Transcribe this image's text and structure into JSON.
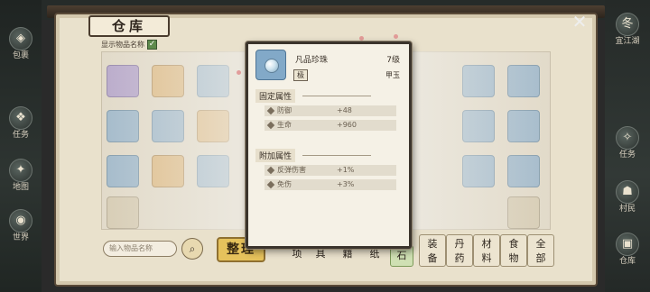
{
  "hud": {
    "left_buttons": [
      {
        "label": "包裹"
      },
      {
        "label": "任务"
      },
      {
        "label": "地图"
      },
      {
        "label": "世界"
      }
    ],
    "right_buttons": [
      {
        "label": "冬",
        "sub": "宜江湖"
      },
      {
        "label": "任务"
      },
      {
        "label": "村民"
      },
      {
        "label": "仓库"
      }
    ]
  },
  "warehouse": {
    "title": "仓库",
    "show_names_label": "显示物品名称",
    "show_names_checked": "✓",
    "slots": [
      {
        "label": "",
        "tone": "purple"
      },
      {
        "label": "",
        "tone": "orange"
      },
      {
        "label": "",
        "tone": "blue"
      },
      {
        "label": "",
        "tone": "blue"
      },
      {
        "label": "",
        "tone": "blue"
      },
      {
        "label": "",
        "tone": "blue"
      },
      {
        "label": "",
        "tone": "blue"
      },
      {
        "label": "",
        "tone": "orange"
      },
      {
        "label": "",
        "tone": "blue"
      },
      {
        "label": "",
        "tone": "blue"
      },
      {
        "label": "",
        "tone": "blue"
      },
      {
        "label": "",
        "tone": "orange"
      },
      {
        "label": "",
        "tone": "blue"
      },
      {
        "label": "",
        "tone": "blue"
      },
      {
        "label": "",
        "tone": "blue"
      }
    ],
    "search_placeholder": "输入物品名称",
    "sort_button": "整理",
    "bottom_tabs": [
      "项",
      "具",
      "籍",
      "纸",
      "石"
    ],
    "category_tabs": [
      {
        "line1": "装",
        "line2": "备"
      },
      {
        "line1": "丹",
        "line2": "药"
      },
      {
        "line1": "材",
        "line2": "料"
      },
      {
        "line1": "食",
        "line2": "物"
      },
      {
        "line1": "全",
        "line2": "部"
      }
    ]
  },
  "tooltip": {
    "item_name": "凡品珍珠",
    "item_level": "7级",
    "rarity_tag": "极",
    "item_type": "甲玉",
    "fixed_header": "固定属性",
    "fixed_stats": [
      {
        "name": "防御",
        "value": "+48"
      },
      {
        "name": "生命",
        "value": "+960"
      }
    ],
    "extra_header": "附加属性",
    "extra_stats": [
      {
        "name": "反弹伤害",
        "value": "+1%"
      },
      {
        "name": "免伤",
        "value": "+3%"
      }
    ]
  },
  "colors": {
    "panel_bg": "#e9e1cc",
    "tooltip_bg": "#f5f1e6",
    "accent_gold": "#e6c25c",
    "slot_blue": "#7fa3c0",
    "checkbox_green": "#5e8a4c"
  },
  "icons": {
    "close": "close-icon",
    "search": "search-icon",
    "item": "pearl-icon"
  }
}
